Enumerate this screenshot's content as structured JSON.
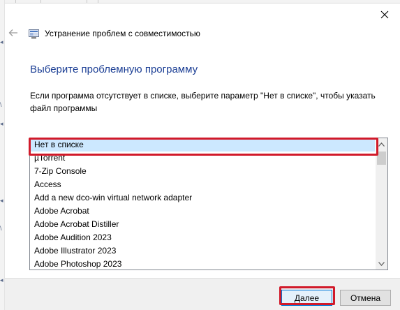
{
  "window": {
    "title": "Устранение проблем с совместимостью"
  },
  "page": {
    "heading": "Выберите проблемную программу",
    "instructions": "Если программа отсутствует в списке, выберите параметр \"Нет в списке\", чтобы указать файл программы"
  },
  "program_list": {
    "selected_index": 0,
    "items": [
      "Нет в списке",
      "µTorrent",
      "7-Zip Console",
      "Access",
      "Add a new dco-win virtual network adapter",
      "Adobe Acrobat",
      "Adobe Acrobat Distiller",
      "Adobe Audition 2023",
      "Adobe Illustrator 2023",
      "Adobe Photoshop 2023"
    ]
  },
  "buttons": {
    "next_label": "Далее",
    "cancel_label": "Отмена"
  },
  "icons": {
    "close": "close-icon",
    "back": "back-arrow-icon",
    "app": "compatibility-troubleshooter-icon",
    "scroll_up": "chevron-up-icon",
    "scroll_down": "chevron-down-icon"
  },
  "colors": {
    "heading": "#1c3f95",
    "selection": "#cce8ff",
    "annotation": "#d11a2a",
    "primary_button_border": "#0078d7"
  }
}
